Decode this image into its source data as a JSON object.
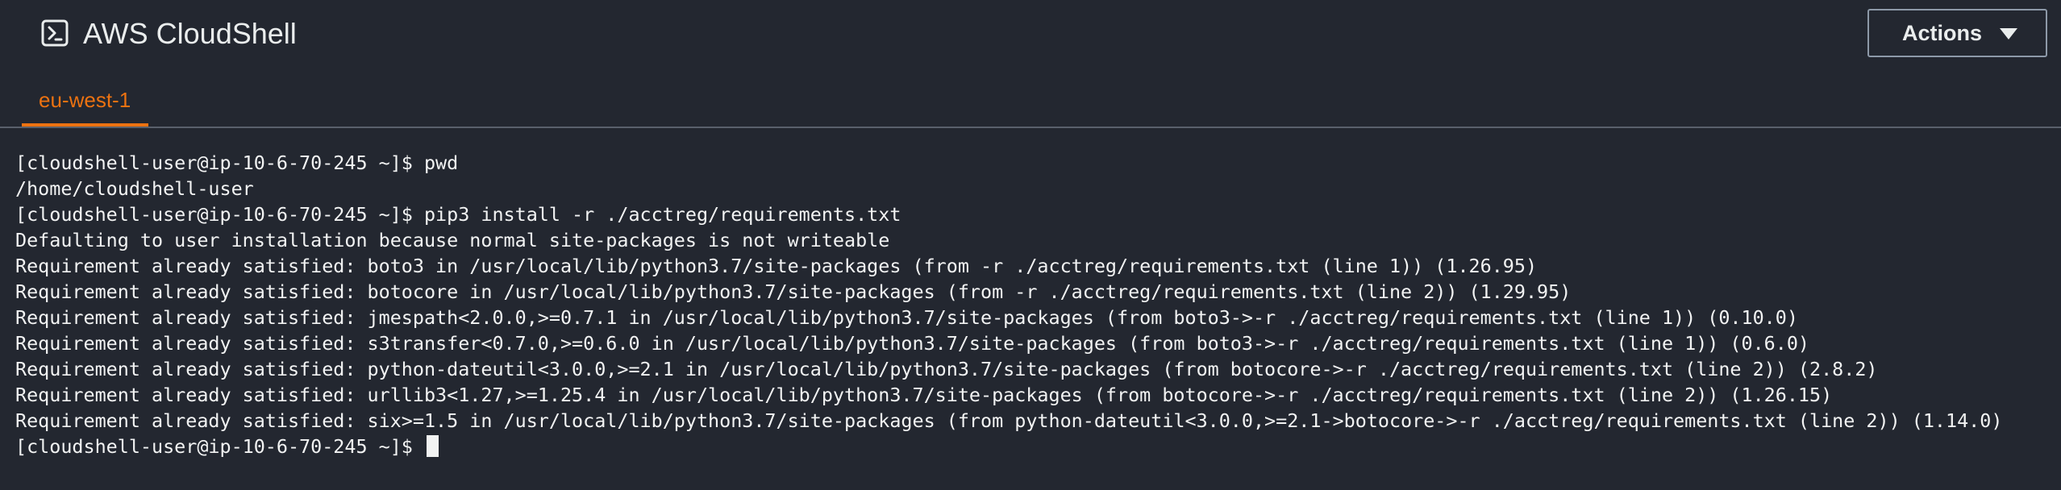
{
  "header": {
    "app_icon": "terminal-prompt-icon",
    "title": "AWS CloudShell",
    "actions_label": "Actions",
    "actions_icon": "caret-down-icon"
  },
  "tabs": [
    {
      "label": "eu-west-1",
      "active": true
    }
  ],
  "colors": {
    "background": "#232730",
    "accent": "#ec7211",
    "text": "#f2f3f3",
    "divider": "#59606b",
    "button_border": "#8d99a8"
  },
  "terminal": {
    "lines": [
      "[cloudshell-user@ip-10-6-70-245 ~]$ pwd",
      "/home/cloudshell-user",
      "[cloudshell-user@ip-10-6-70-245 ~]$ pip3 install -r ./acctreg/requirements.txt",
      "Defaulting to user installation because normal site-packages is not writeable",
      "Requirement already satisfied: boto3 in /usr/local/lib/python3.7/site-packages (from -r ./acctreg/requirements.txt (line 1)) (1.26.95)",
      "Requirement already satisfied: botocore in /usr/local/lib/python3.7/site-packages (from -r ./acctreg/requirements.txt (line 2)) (1.29.95)",
      "Requirement already satisfied: jmespath<2.0.0,>=0.7.1 in /usr/local/lib/python3.7/site-packages (from boto3->-r ./acctreg/requirements.txt (line 1)) (0.10.0)",
      "Requirement already satisfied: s3transfer<0.7.0,>=0.6.0 in /usr/local/lib/python3.7/site-packages (from boto3->-r ./acctreg/requirements.txt (line 1)) (0.6.0)",
      "Requirement already satisfied: python-dateutil<3.0.0,>=2.1 in /usr/local/lib/python3.7/site-packages (from botocore->-r ./acctreg/requirements.txt (line 2)) (2.8.2)",
      "Requirement already satisfied: urllib3<1.27,>=1.25.4 in /usr/local/lib/python3.7/site-packages (from botocore->-r ./acctreg/requirements.txt (line 2)) (1.26.15)",
      "Requirement already satisfied: six>=1.5 in /usr/local/lib/python3.7/site-packages (from python-dateutil<3.0.0,>=2.1->botocore->-r ./acctreg/requirements.txt (line 2)) (1.14.0)"
    ],
    "prompt": "[cloudshell-user@ip-10-6-70-245 ~]$ "
  }
}
